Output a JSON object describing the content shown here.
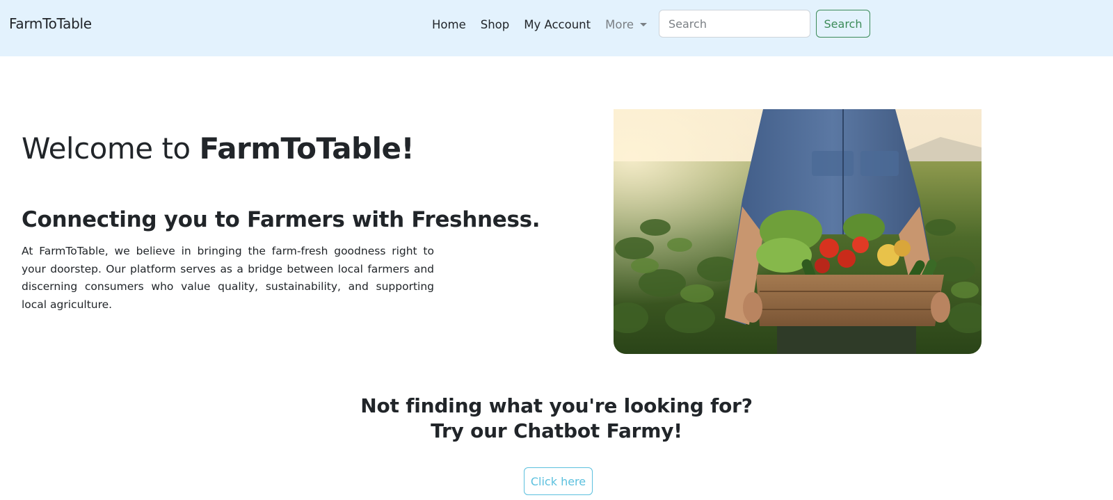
{
  "navbar": {
    "brand": "FarmToTable",
    "links": [
      {
        "label": "Home"
      },
      {
        "label": "Shop"
      },
      {
        "label": "My Account"
      }
    ],
    "more_label": "More",
    "search_placeholder": "Search",
    "search_button": "Search",
    "background": "#e3f2fd"
  },
  "hero": {
    "title_prefix": "Welcome to ",
    "title_brand": "FarmToTable!",
    "subtitle": "Connecting you to Farmers with Freshness.",
    "description": "At FarmToTable, we believe in bringing the farm-fresh goodness right to your doorstep. Our platform serves as a bridge between local farmers and discerning consumers who value quality, sustainability, and supporting local agriculture."
  },
  "cta": {
    "line1": "Not finding what you're looking for?",
    "line2": "Try our Chatbot Farmy!",
    "button": "Click here"
  },
  "colors": {
    "success": "#3b8a57",
    "info": "#5bc0de",
    "text": "#212529"
  },
  "icons": {
    "more_dropdown": "chevron-down-icon",
    "hero_image": "farmer-holding-vegetable-crate"
  }
}
